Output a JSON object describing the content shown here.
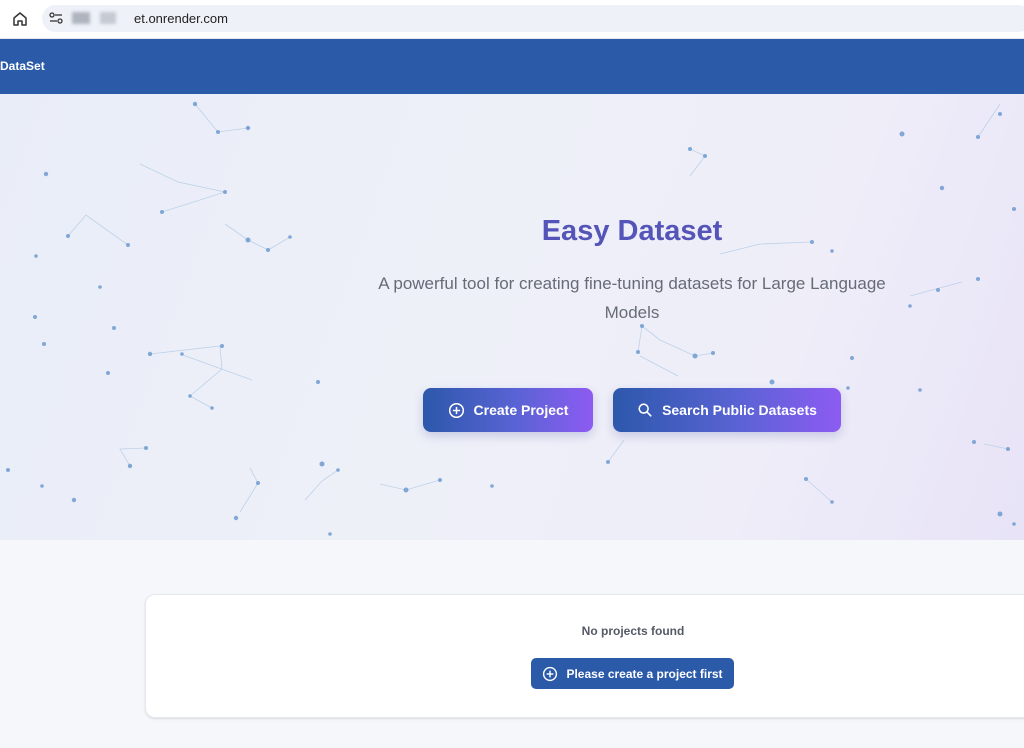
{
  "browser": {
    "url_visible": "et.onrender.com"
  },
  "header": {
    "app_title": "DataSet"
  },
  "hero": {
    "title": "Easy Dataset",
    "subtitle": "A powerful tool for creating fine-tuning datasets for Large Language Models",
    "create_button_label": "Create Project",
    "search_button_label": "Search Public Datasets"
  },
  "projects": {
    "empty_text": "No projects found",
    "create_first_label": "Please create a project first"
  },
  "colors": {
    "header_bg": "#2b5aa9",
    "title_color": "#5554b9",
    "button_gradient_start": "#2c58ab",
    "button_gradient_end": "#8d5bf2"
  },
  "icons": [
    "home-icon",
    "site-info-icon",
    "plus-circle-icon",
    "search-icon"
  ]
}
